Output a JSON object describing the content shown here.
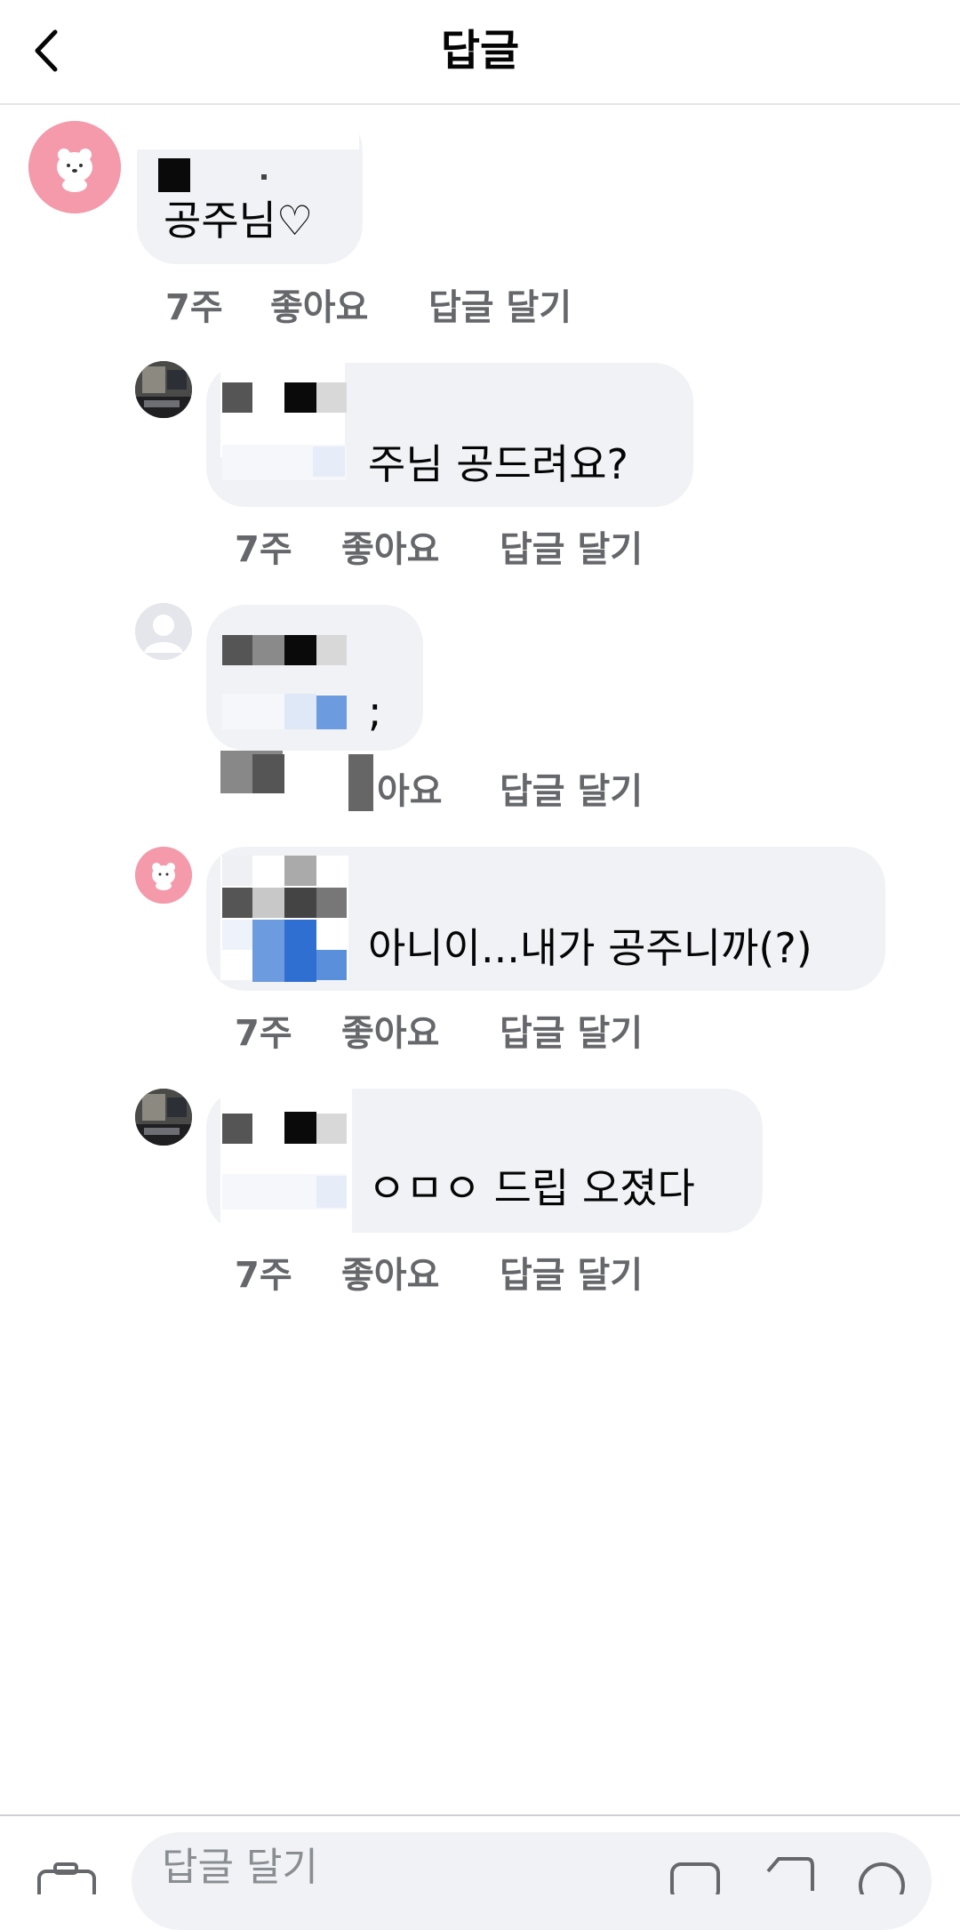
{
  "header": {
    "title": "답글"
  },
  "comments": [
    {
      "text": "공주님♡",
      "time": "7주",
      "like": "좋아요",
      "reply": "답글 달기"
    },
    {
      "text": "주님 공드려요?",
      "time": "7주",
      "like": "좋아요",
      "reply": "답글 달기"
    },
    {
      "text": ";",
      "time": "",
      "like": "아요",
      "reply": "답글 달기"
    },
    {
      "text": "아니이...내가 공주니까(?)",
      "time": "7주",
      "like": "좋아요",
      "reply": "답글 달기"
    },
    {
      "text": "ㅇㅁㅇ 드립 오졌다",
      "time": "7주",
      "like": "좋아요",
      "reply": "답글 달기"
    }
  ],
  "composer": {
    "placeholder": "답글 달기"
  },
  "colors": {
    "bubble": "#f0f2f5",
    "meta": "#65676b",
    "avatar_pink": "#f49aab"
  }
}
